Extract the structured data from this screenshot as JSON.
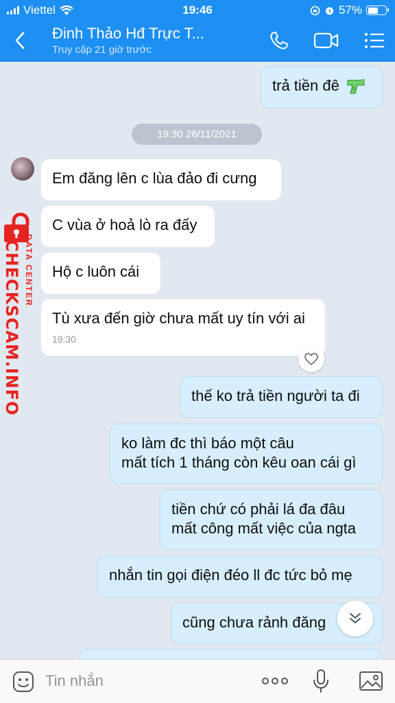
{
  "status_bar": {
    "carrier": "Viettel",
    "time": "19:46",
    "battery": "57%",
    "battery_level": 0.57
  },
  "header": {
    "title": "Đinh Thảo Hđ Trực T...",
    "subtitle": "Truy cập 21 giờ trước"
  },
  "messages": {
    "m0": {
      "text": "trả tiền đê",
      "emoji": "water-pistol"
    },
    "timestamp": "19:30 26/11/2021",
    "m1": {
      "text": "Em đăng lên c lùa đảo đi cưng"
    },
    "m2": {
      "text": "C vùa ở hoả lò ra đấy"
    },
    "m3": {
      "text": "Hộ c luôn cái"
    },
    "m4": {
      "text": "Tù xưa đến giờ chưa mất uy tín với ai",
      "time": "19:30"
    },
    "m5": {
      "text": "thế ko trả tiền người ta đi"
    },
    "m6": {
      "lines": [
        "ko làm đc thì báo một câu",
        "mất tích 1 tháng còn kêu oan cái gì"
      ]
    },
    "m7": {
      "lines": [
        "tiền chứ có phải lá đa đâu",
        "mất công mất việc của ngta"
      ]
    },
    "m8": {
      "text": "nhắn tin gọi điện đéo ll đc tức bỏ mẹ"
    },
    "m9": {
      "text": "cũng chưa rảnh đăng"
    }
  },
  "watermark": {
    "brand": "CHECKSCAM.INFO",
    "sub": "DATA CENTER"
  },
  "composer": {
    "placeholder": "Tin nhắn"
  },
  "icons": [
    "back-icon",
    "phone-icon",
    "video-call-icon",
    "menu-icon",
    "heart-icon",
    "chevron-down-icon",
    "sticker-icon",
    "more-icon",
    "microphone-icon",
    "image-icon",
    "lock-icon"
  ],
  "colors": {
    "header": "#1d8ff2",
    "chat_background": "#e2e8ef",
    "outgoing_bubble": "#d7eefe",
    "incoming_bubble": "#ffffff",
    "watermark": "#e52421"
  }
}
